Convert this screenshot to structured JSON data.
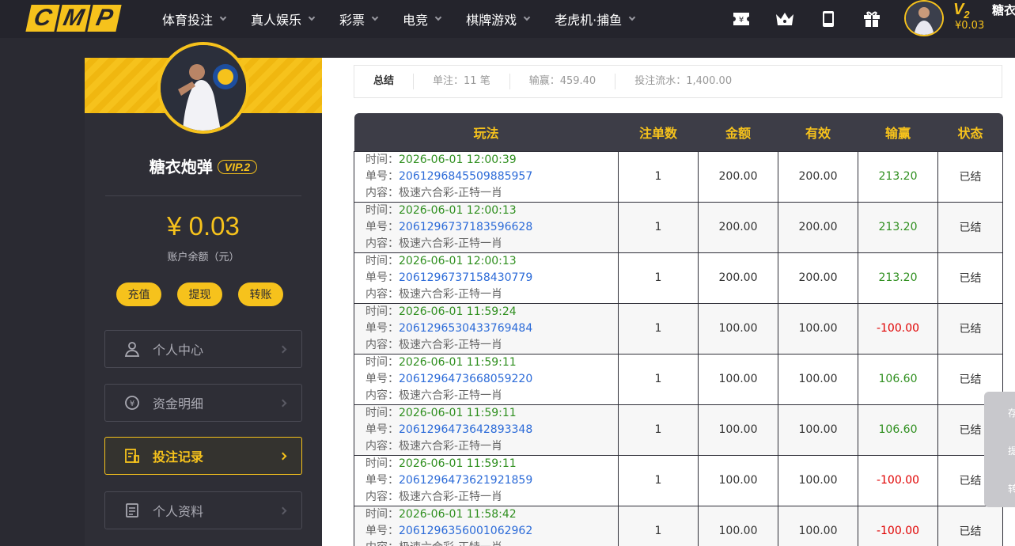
{
  "logo": [
    "C",
    "M",
    "P"
  ],
  "nav": [
    {
      "label": "体育投注"
    },
    {
      "label": "真人娱乐"
    },
    {
      "label": "彩票"
    },
    {
      "label": "电竞"
    },
    {
      "label": "棋牌游戏"
    },
    {
      "label": "老虎机·捕鱼"
    }
  ],
  "top_user": {
    "vip": "V",
    "vip_level": "2",
    "balance": "¥0.03",
    "name": "糖衣"
  },
  "profile": {
    "username": "糖衣炮弹",
    "vip_badge": "VIP.2",
    "balance": "¥ 0.03",
    "balance_label": "账户余额（元）",
    "actions": [
      "充值",
      "提现",
      "转账"
    ]
  },
  "menu": [
    {
      "label": "个人中心",
      "icon": "user-icon"
    },
    {
      "label": "资金明细",
      "icon": "money-icon"
    },
    {
      "label": "投注记录",
      "icon": "bet-record-icon",
      "active": true
    },
    {
      "label": "个人资料",
      "icon": "profile-doc-icon"
    }
  ],
  "summary": {
    "title": "总结",
    "bets": "单注：11 笔",
    "winloss": "输赢：459.40",
    "turnover": "投注流水：1,400.00"
  },
  "table": {
    "headers": [
      "玩法",
      "注单数",
      "金额",
      "有效",
      "输赢",
      "状态"
    ],
    "labels": {
      "time": "时间：",
      "order": "单号：",
      "content": "内容：极速六合彩-正特一肖"
    },
    "rows": [
      {
        "time": "2026-06-01 12:00:39",
        "order": "2061296845509885957",
        "count": "1",
        "amount": "200.00",
        "valid": "200.00",
        "winloss": "213.20",
        "result": "win",
        "status": "已结"
      },
      {
        "time": "2026-06-01 12:00:13",
        "order": "2061296737183596628",
        "count": "1",
        "amount": "200.00",
        "valid": "200.00",
        "winloss": "213.20",
        "result": "win",
        "status": "已结"
      },
      {
        "time": "2026-06-01 12:00:13",
        "order": "2061296737158430779",
        "count": "1",
        "amount": "200.00",
        "valid": "200.00",
        "winloss": "213.20",
        "result": "win",
        "status": "已结"
      },
      {
        "time": "2026-06-01 11:59:24",
        "order": "2061296530433769484",
        "count": "1",
        "amount": "100.00",
        "valid": "100.00",
        "winloss": "-100.00",
        "result": "lose",
        "status": "已结"
      },
      {
        "time": "2026-06-01 11:59:11",
        "order": "2061296473668059220",
        "count": "1",
        "amount": "100.00",
        "valid": "100.00",
        "winloss": "106.60",
        "result": "win",
        "status": "已结"
      },
      {
        "time": "2026-06-01 11:59:11",
        "order": "2061296473642893348",
        "count": "1",
        "amount": "100.00",
        "valid": "100.00",
        "winloss": "106.60",
        "result": "win",
        "status": "已结"
      },
      {
        "time": "2026-06-01 11:59:11",
        "order": "2061296473621921859",
        "count": "1",
        "amount": "100.00",
        "valid": "100.00",
        "winloss": "-100.00",
        "result": "lose",
        "status": "已结"
      },
      {
        "time": "2026-06-01 11:58:42",
        "order": "2061296356001062962",
        "count": "1",
        "amount": "100.00",
        "valid": "100.00",
        "winloss": "-100.00",
        "result": "lose",
        "status": "已结"
      }
    ]
  },
  "float_tab": [
    "存",
    "提",
    "转"
  ],
  "colors": {
    "accent": "#f6c21c",
    "nav_bg": "#24242c",
    "win": "#2f8f1f",
    "lose": "#e00000",
    "order_link": "#2c6bd8"
  }
}
